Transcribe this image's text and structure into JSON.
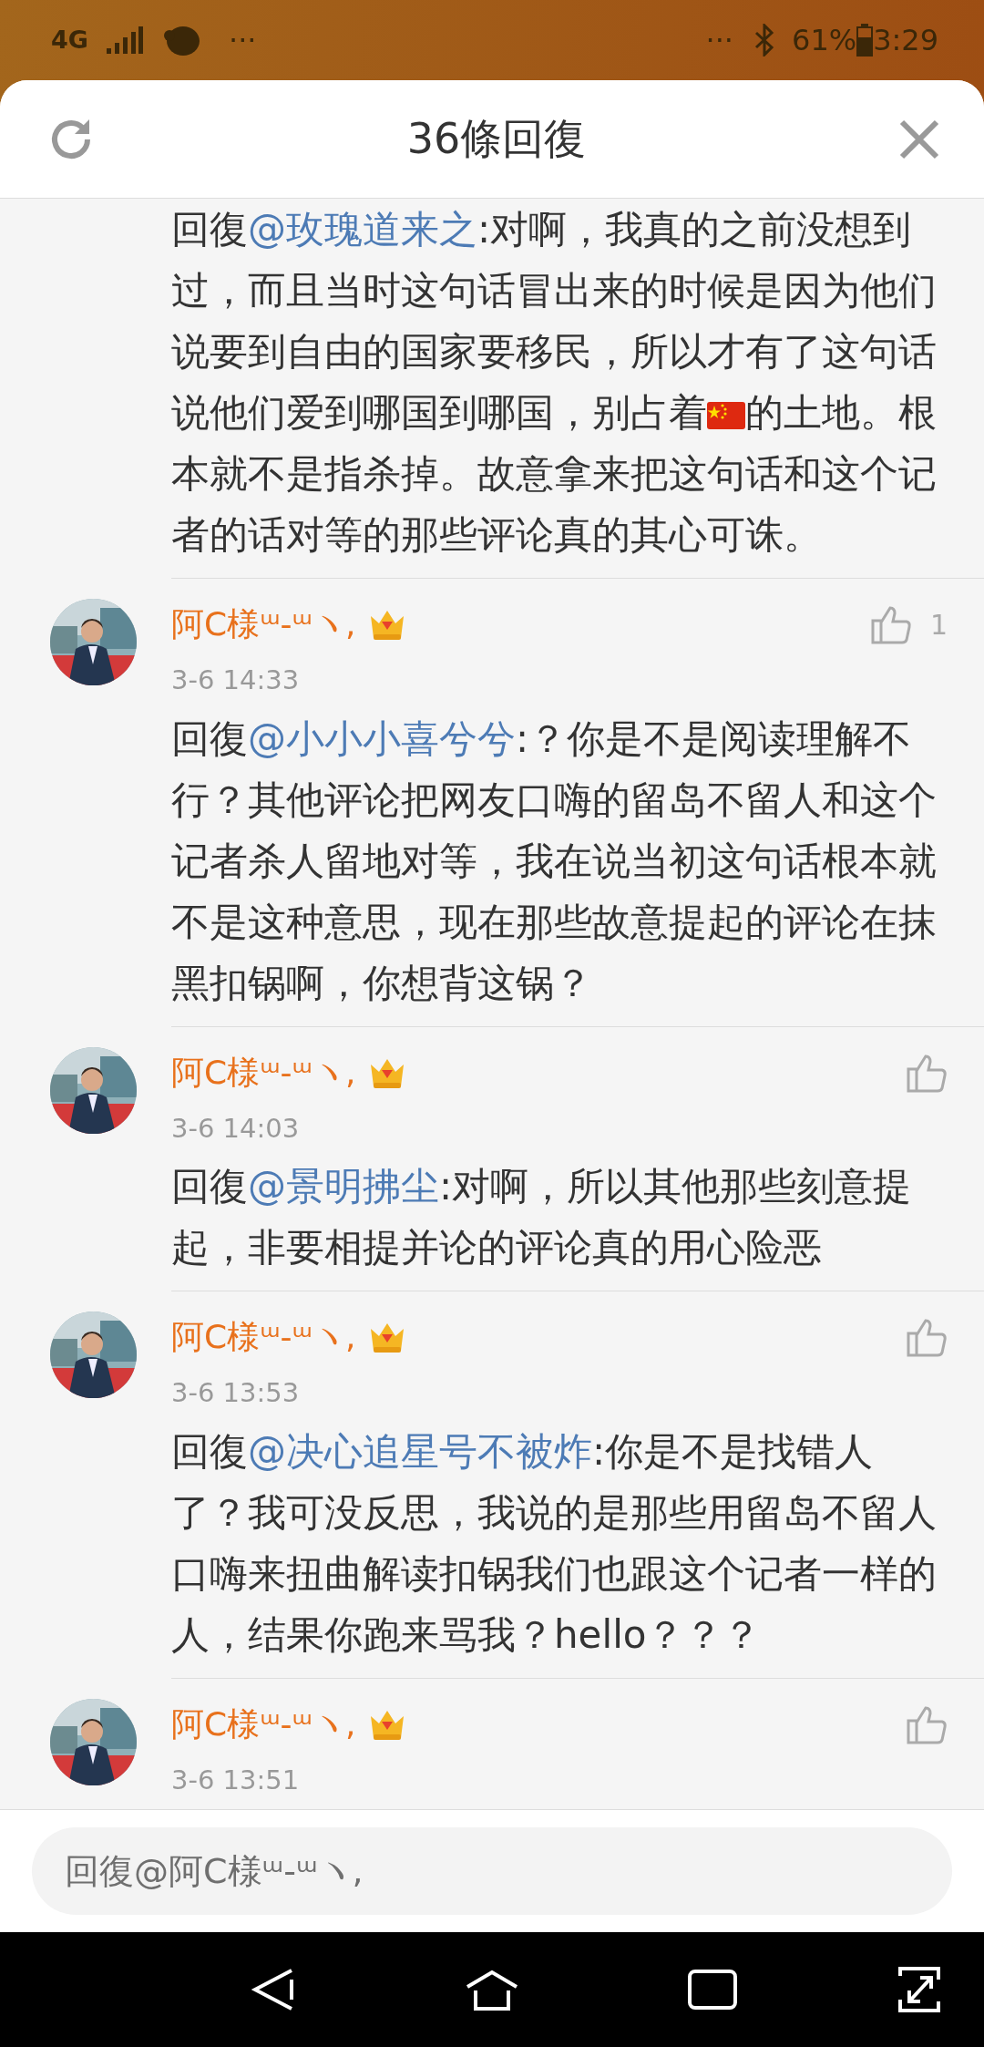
{
  "status_bar": {
    "network": "4G",
    "left_more": "···",
    "right_more": "···",
    "battery": "61%",
    "time": "3:29"
  },
  "header": {
    "title": "36條回復"
  },
  "comments": [
    {
      "body": [
        {
          "kind": "text",
          "text": "回復"
        },
        {
          "kind": "mention",
          "text": "@玫瑰道来之"
        },
        {
          "kind": "text",
          "text": ":对啊，我真的之前没想到过，而且当时这句话冒出来的时候是因为他们说要到自由的国家要移民，所以才有了这句话说他们爱到哪国到哪国，别占着"
        },
        {
          "kind": "flag"
        },
        {
          "kind": "text",
          "text": "的土地。根本就不是指杀掉。故意拿来把这句话和这个记者的话对等的那些评论真的其心可诛。"
        }
      ]
    },
    {
      "name": "阿C様ᵚ-ᵚヽ,",
      "time": "3-6 14:33",
      "likes": "1",
      "body": [
        {
          "kind": "text",
          "text": "回復"
        },
        {
          "kind": "mention",
          "text": "@小小小喜兮兮"
        },
        {
          "kind": "text",
          "text": ":？你是不是阅读理解不行？其他评论把网友口嗨的留岛不留人和这个记者杀人留地对等，我在说当初这句话根本就不是这种意思，现在那些故意提起的评论在抹黑扣锅啊，你想背这锅？"
        }
      ]
    },
    {
      "name": "阿C様ᵚ-ᵚヽ,",
      "time": "3-6 14:03",
      "body": [
        {
          "kind": "text",
          "text": "回復"
        },
        {
          "kind": "mention",
          "text": "@景明拂尘"
        },
        {
          "kind": "text",
          "text": ":对啊，所以其他那些刻意提起，非要相提并论的评论真的用心险恶"
        }
      ]
    },
    {
      "name": "阿C様ᵚ-ᵚヽ,",
      "time": "3-6 13:53",
      "body": [
        {
          "kind": "text",
          "text": "回復"
        },
        {
          "kind": "mention",
          "text": "@决心追星号不被炸"
        },
        {
          "kind": "text",
          "text": ":你是不是找错人了？我可没反思，我说的是那些用留岛不留人口嗨来扭曲解读扣锅我们也跟这个记者一样的人，结果你跑来骂我？hello？？？"
        }
      ]
    },
    {
      "name": "阿C様ᵚ-ᵚヽ,",
      "time": "3-6 13:51"
    }
  ],
  "reply_field": {
    "placeholder": "回復@阿C様ᵚ-ᵚヽ,"
  }
}
